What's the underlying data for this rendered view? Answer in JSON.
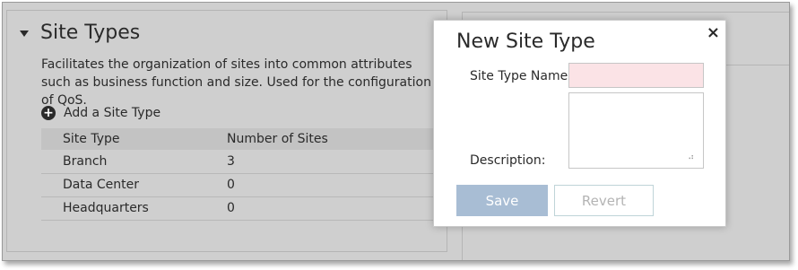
{
  "section": {
    "title": "Site Types",
    "description": "Facilitates the organization of sites into common attributes such as business function and size. Used for the configuration of QoS.",
    "add_label": "Add a Site Type"
  },
  "table": {
    "headers": [
      "Site Type",
      "Number of Sites"
    ],
    "rows": [
      [
        "Branch",
        "3"
      ],
      [
        "Data Center",
        "0"
      ],
      [
        "Headquarters",
        "0"
      ]
    ]
  },
  "dialog": {
    "title": "New Site Type",
    "close_glyph": "×",
    "name_label": "Site Type Name:",
    "name_value": "",
    "description_label": "Description:",
    "description_value": "",
    "save_label": "Save",
    "revert_label": "Revert",
    "name_field_error_color": "#fbe3e6",
    "save_button_color": "#a8bdd4"
  }
}
